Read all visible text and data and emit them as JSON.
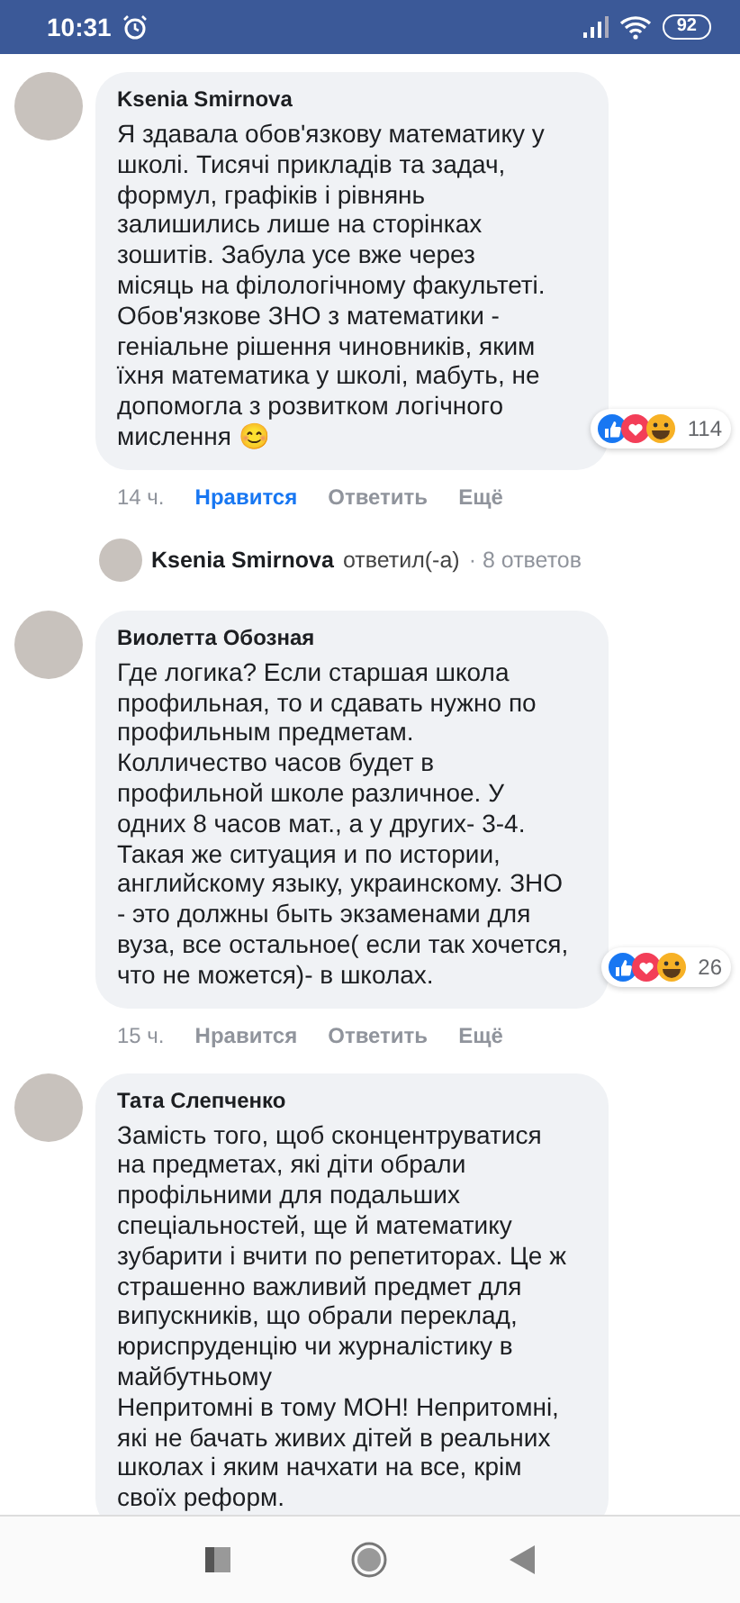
{
  "status_bar": {
    "time": "10:31",
    "battery": "92"
  },
  "comments": [
    {
      "author": "Ksenia Smirnova",
      "text": "Я здавала обов'язкову математику у\nшколі. Тисячі прикладів та задач,\nформул, графіків і рівнянь\nзалишились лише на сторінках\nзошитів. Забула усе вже через\nмісяць на філологічному факультеті.\nОбов'язкове ЗНО з математики -\nгеніальне рішення чиновників, яким\nїхня математика у школі, мабуть, не\nдопомогла з розвитком логічного\nмислення 😊",
      "reactions_count": "114",
      "time": "14 ч.",
      "like_label": "Нравится",
      "liked": true,
      "reply_label": "Ответить",
      "more_label": "Ещё",
      "replies": {
        "author": "Ksenia Smirnova",
        "action": "ответил(-а)",
        "count": "· 8 ответов"
      }
    },
    {
      "author": "Виолетта Обозная",
      "text": "Где логика? Если старшая школа\nпрофильная, то и сдавать нужно по\nпрофильным предметам.\nКолличество часов будет в\nпрофильной школе различное. У\nодних 8 часов мат., а у других- 3-4.\nТакая же ситуация и по истории,\nанглийскому языку, украинскому. ЗНО\n- это должны быть экзаменами для\nвуза, все остальное( если так хочется,\nчто не можется)- в школах.",
      "reactions_count": "26",
      "time": "15 ч.",
      "like_label": "Нравится",
      "liked": false,
      "reply_label": "Ответить",
      "more_label": "Ещё"
    },
    {
      "author": "Тата Слепченко",
      "text": "Замість того, щоб сконцентруватися\nна предметах, які діти обрали\nпрофільними для подальших\nспеціальностей, ще й математику\nзубарити і вчити по репетиторах. Це ж\nстрашенно важливий предмет для\nвипускників, що обрали переклад,\nюриспруденцію чи журналістику в\nмайбутньому\nНепритомні в тому МОН! Непритомні,\nякі не бачать живих дітей в реальних\nшколах і яким начхати на все, крім\nсвоїх реформ."
    }
  ]
}
